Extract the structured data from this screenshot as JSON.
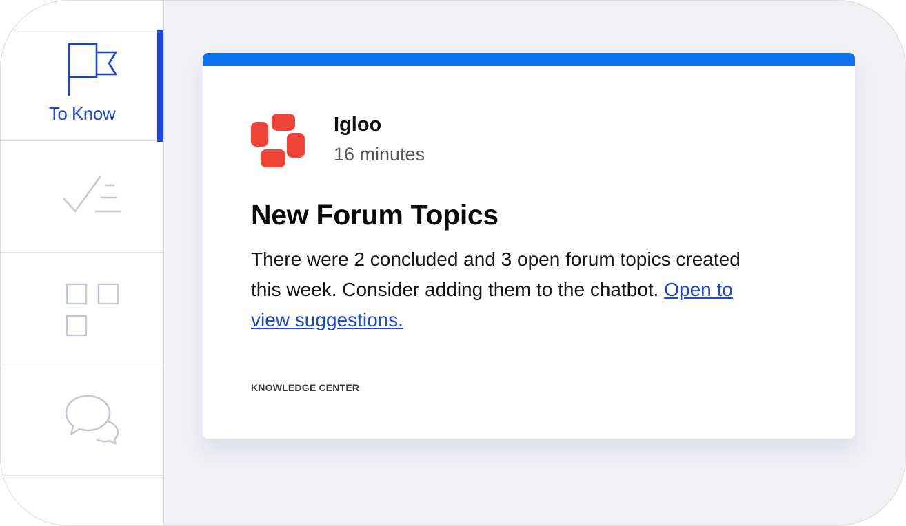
{
  "sidebar": {
    "items": [
      {
        "label": "To Know",
        "icon": "flag-icon",
        "active": true
      },
      {
        "label": "",
        "icon": "checklist-icon",
        "active": false
      },
      {
        "label": "",
        "icon": "grid-icon",
        "active": false
      },
      {
        "label": "",
        "icon": "chat-bubbles-icon",
        "active": false
      }
    ],
    "accent_color": "#1a47d3",
    "inactive_icon_color": "#c3c8d8"
  },
  "card": {
    "accent_color": "#0d70f0",
    "brand": {
      "name": "Igloo",
      "time": "16 minutes",
      "logo_icon": "igloo-logo",
      "logo_color": "#ef4438"
    },
    "title": "New Forum Topics",
    "body_text": "There were 2 concluded and 3 open forum topics created this week. Consider adding them to the chatbot.",
    "link_text": "Open to view suggestions.",
    "footer": "KNOWLEDGE CENTER"
  }
}
